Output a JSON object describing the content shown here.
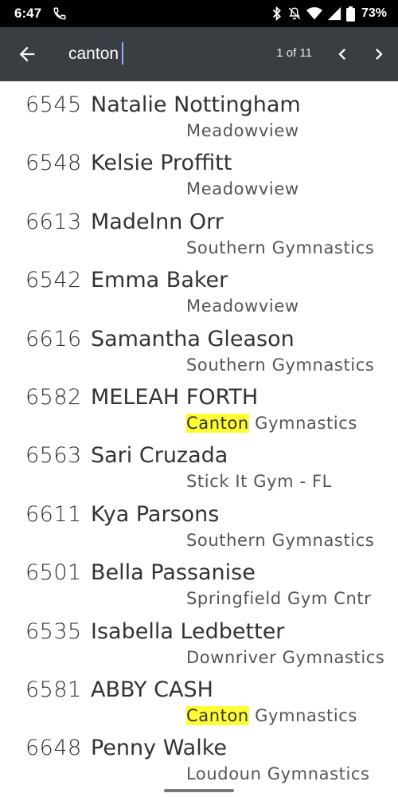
{
  "status_bar": {
    "time": "6:47",
    "battery": "73%",
    "icons": [
      "phone-icon",
      "bluetooth-icon",
      "mute-icon",
      "wifi-icon",
      "signal-icon",
      "battery-icon"
    ]
  },
  "toolbar": {
    "search_value": "canton",
    "match_count": "1 of 11",
    "icons": [
      "back-arrow-icon",
      "chevron-left-icon",
      "chevron-right-icon"
    ]
  },
  "entries": [
    {
      "number": "6545",
      "name": "Natalie Nottingham",
      "team_highlight": "",
      "team_rest": "Meadowview"
    },
    {
      "number": "6548",
      "name": "Kelsie Proffitt",
      "team_highlight": "",
      "team_rest": "Meadowview"
    },
    {
      "number": "6613",
      "name": "Madelnn Orr",
      "team_highlight": "",
      "team_rest": "Southern Gymnastics"
    },
    {
      "number": "6542",
      "name": "Emma Baker",
      "team_highlight": "",
      "team_rest": "Meadowview"
    },
    {
      "number": "6616",
      "name": "Samantha Gleason",
      "team_highlight": "",
      "team_rest": "Southern Gymnastics"
    },
    {
      "number": "6582",
      "name": "MELEAH FORTH",
      "team_highlight": "Canton",
      "team_rest": " Gymnastics"
    },
    {
      "number": "6563",
      "name": "Sari Cruzada",
      "team_highlight": "",
      "team_rest": "Stick It Gym - FL"
    },
    {
      "number": "6611",
      "name": "Kya Parsons",
      "team_highlight": "",
      "team_rest": "Southern Gymnastics"
    },
    {
      "number": "6501",
      "name": "Bella Passanise",
      "team_highlight": "",
      "team_rest": "Springfield Gym Cntr"
    },
    {
      "number": "6535",
      "name": "Isabella Ledbetter",
      "team_highlight": "",
      "team_rest": "Downriver Gymnastics"
    },
    {
      "number": "6581",
      "name": "ABBY CASH",
      "team_highlight": "Canton",
      "team_rest": " Gymnastics"
    },
    {
      "number": "6648",
      "name": "Penny Walke",
      "team_highlight": "",
      "team_rest": "Loudoun Gymnastics"
    }
  ],
  "colors": {
    "status_bar": "#000000",
    "toolbar": "#3a3d41",
    "highlight": "#ffff33",
    "caret": "#8ab4f8"
  }
}
